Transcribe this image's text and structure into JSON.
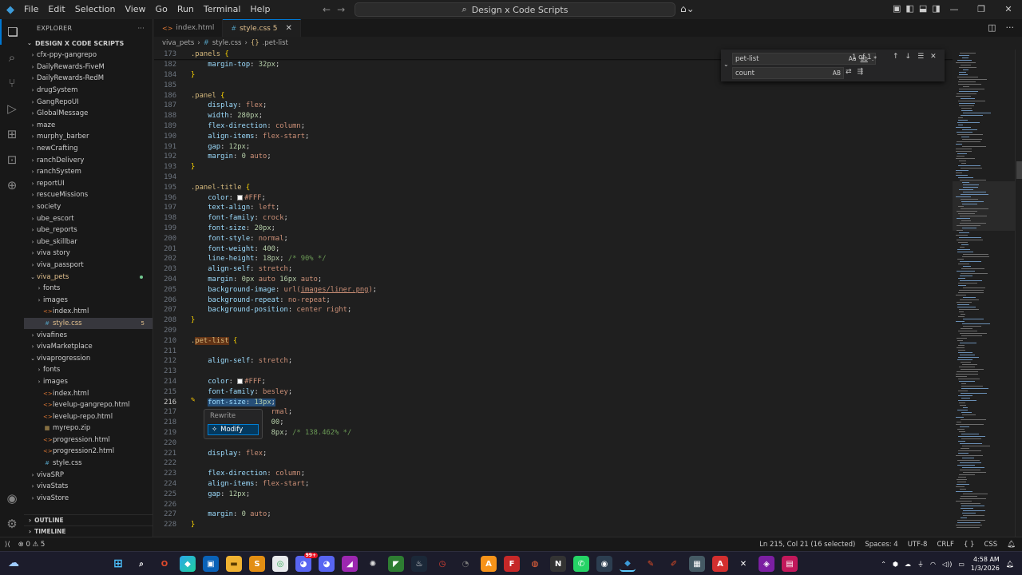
{
  "menu": [
    "File",
    "Edit",
    "Selection",
    "View",
    "Go",
    "Run",
    "Terminal",
    "Help"
  ],
  "command_center": "Design x Code Scripts",
  "explorer": {
    "title": "EXPLORER",
    "folder": "DESIGN X CODE SCRIPTS",
    "tree": [
      {
        "label": "cfx-ppy-gangrepo",
        "depth": 1,
        "chev": "›"
      },
      {
        "label": "DailyRewards-FiveM",
        "depth": 1,
        "chev": "›"
      },
      {
        "label": "DailyRewards-RedM",
        "depth": 1,
        "chev": "›"
      },
      {
        "label": "drugSystem",
        "depth": 1,
        "chev": "›"
      },
      {
        "label": "GangRepoUI",
        "depth": 1,
        "chev": "›"
      },
      {
        "label": "GlobalMessage",
        "depth": 1,
        "chev": "›"
      },
      {
        "label": "maze",
        "depth": 1,
        "chev": "›"
      },
      {
        "label": "murphy_barber",
        "depth": 1,
        "chev": "›"
      },
      {
        "label": "newCrafting",
        "depth": 1,
        "chev": "›"
      },
      {
        "label": "ranchDelivery",
        "depth": 1,
        "chev": "›"
      },
      {
        "label": "ranchSystem",
        "depth": 1,
        "chev": "›"
      },
      {
        "label": "reportUI",
        "depth": 1,
        "chev": "›"
      },
      {
        "label": "rescueMissions",
        "depth": 1,
        "chev": "›"
      },
      {
        "label": "society",
        "depth": 1,
        "chev": "›"
      },
      {
        "label": "ube_escort",
        "depth": 1,
        "chev": "›"
      },
      {
        "label": "ube_reports",
        "depth": 1,
        "chev": "›"
      },
      {
        "label": "ube_skillbar",
        "depth": 1,
        "chev": "›"
      },
      {
        "label": "viva story",
        "depth": 1,
        "chev": "›"
      },
      {
        "label": "viva_passport",
        "depth": 1,
        "chev": "›"
      },
      {
        "label": "viva_pets",
        "depth": 1,
        "chev": "⌄",
        "mod": true,
        "dot": true
      },
      {
        "label": "fonts",
        "depth": 2,
        "chev": "›"
      },
      {
        "label": "images",
        "depth": 2,
        "chev": "›"
      },
      {
        "label": "index.html",
        "depth": 2,
        "chev": "",
        "icon": "<>",
        "iconColor": "#e37933"
      },
      {
        "label": "style.css",
        "depth": 2,
        "chev": "",
        "icon": "#",
        "iconColor": "#519aba",
        "selected": true,
        "mod": true,
        "badge": "5"
      },
      {
        "label": "vivafines",
        "depth": 1,
        "chev": "›"
      },
      {
        "label": "vivaMarketplace",
        "depth": 1,
        "chev": "›"
      },
      {
        "label": "vivaprogression",
        "depth": 1,
        "chev": "⌄"
      },
      {
        "label": "fonts",
        "depth": 2,
        "chev": "›"
      },
      {
        "label": "images",
        "depth": 2,
        "chev": "›"
      },
      {
        "label": "index.html",
        "depth": 2,
        "chev": "",
        "icon": "<>",
        "iconColor": "#e37933"
      },
      {
        "label": "levelup-gangrepo.html",
        "depth": 2,
        "chev": "",
        "icon": "<>",
        "iconColor": "#e37933"
      },
      {
        "label": "levelup-repo.html",
        "depth": 2,
        "chev": "",
        "icon": "<>",
        "iconColor": "#e37933"
      },
      {
        "label": "myrepo.zip",
        "depth": 2,
        "chev": "",
        "icon": "▦",
        "iconColor": "#c5a15a"
      },
      {
        "label": "progression.html",
        "depth": 2,
        "chev": "",
        "icon": "<>",
        "iconColor": "#e37933"
      },
      {
        "label": "progression2.html",
        "depth": 2,
        "chev": "",
        "icon": "<>",
        "iconColor": "#e37933"
      },
      {
        "label": "style.css",
        "depth": 2,
        "chev": "",
        "icon": "#",
        "iconColor": "#519aba"
      },
      {
        "label": "vivaSRP",
        "depth": 1,
        "chev": "›"
      },
      {
        "label": "vivaStats",
        "depth": 1,
        "chev": "›"
      },
      {
        "label": "vivaStore",
        "depth": 1,
        "chev": "›"
      }
    ],
    "outline": "OUTLINE",
    "timeline": "TIMELINE"
  },
  "tabs": [
    {
      "label": "index.html",
      "icon": "<>",
      "active": false
    },
    {
      "label": "style.css 5",
      "icon": "#",
      "active": true
    }
  ],
  "breadcrumb": [
    "viva_pets",
    "#",
    "style.css",
    "{}",
    ".pet-list"
  ],
  "find": {
    "search_value": "pet-list",
    "replace_value": "count",
    "match_count": "1 of 1",
    "opt_case": "Aa",
    "opt_word": "ab",
    "opt_regex": ".*",
    "opt_preserve": "AB"
  },
  "code_action": {
    "title": "Rewrite",
    "item": "Modify"
  },
  "code_lines": [
    {
      "n": "173",
      "html": "<span class='sel'>.panels</span> <span class='brace'>{</span>"
    },
    {
      "n": "182",
      "html": "    <span class='prop'>margin-top</span>: <span class='num'>32px</span>;"
    },
    {
      "n": "184",
      "html": "<span class='brace'>}</span>"
    },
    {
      "n": "185",
      "html": ""
    },
    {
      "n": "186",
      "html": "<span class='sel'>.panel</span> <span class='brace'>{</span>"
    },
    {
      "n": "187",
      "html": "    <span class='prop'>display</span>: <span class='val'>flex</span>;"
    },
    {
      "n": "188",
      "html": "    <span class='prop'>width</span>: <span class='num'>280px</span>;"
    },
    {
      "n": "189",
      "html": "    <span class='prop'>flex-direction</span>: <span class='val'>column</span>;"
    },
    {
      "n": "190",
      "html": "    <span class='prop'>align-items</span>: <span class='val'>flex-start</span>;"
    },
    {
      "n": "191",
      "html": "    <span class='prop'>gap</span>: <span class='num'>12px</span>;"
    },
    {
      "n": "192",
      "html": "    <span class='prop'>margin</span>: <span class='num'>0</span> <span class='val'>auto</span>;"
    },
    {
      "n": "193",
      "html": "<span class='brace'>}</span>"
    },
    {
      "n": "194",
      "html": ""
    },
    {
      "n": "195",
      "html": "<span class='sel'>.panel-title</span> <span class='brace'>{</span>"
    },
    {
      "n": "196",
      "html": "    <span class='prop'>color</span>: <span class='swatch'></span><span class='val'>#FFF</span>;"
    },
    {
      "n": "197",
      "html": "    <span class='prop'>text-align</span>: <span class='val'>left</span>;"
    },
    {
      "n": "198",
      "html": "    <span class='prop'>font-family</span>: <span class='val'>crock</span>;"
    },
    {
      "n": "199",
      "html": "    <span class='prop'>font-size</span>: <span class='num'>20px</span>;"
    },
    {
      "n": "200",
      "html": "    <span class='prop'>font-style</span>: <span class='val'>normal</span>;"
    },
    {
      "n": "201",
      "html": "    <span class='prop'>font-weight</span>: <span class='num'>400</span>;"
    },
    {
      "n": "202",
      "html": "    <span class='prop'>line-height</span>: <span class='num'>18px</span>; <span class='cmt'>/* 90% */</span>"
    },
    {
      "n": "203",
      "html": "    <span class='prop'>align-self</span>: <span class='val'>stretch</span>;"
    },
    {
      "n": "204",
      "html": "    <span class='prop'>margin</span>: <span class='num'>0px</span> <span class='val'>auto</span> <span class='num'>16px</span> <span class='val'>auto</span>;"
    },
    {
      "n": "205",
      "html": "    <span class='prop'>background-image</span>: <span class='val'>url(</span><span class='val' style='text-decoration:underline'>images/liner.png</span><span class='val'>)</span>;"
    },
    {
      "n": "206",
      "html": "    <span class='prop'>background-repeat</span>: <span class='val'>no-repeat</span>;"
    },
    {
      "n": "207",
      "html": "    <span class='prop'>background-position</span>: <span class='val'>center right</span>;"
    },
    {
      "n": "208",
      "html": "<span class='brace'>}</span>"
    },
    {
      "n": "209",
      "html": ""
    },
    {
      "n": "210",
      "html": "<span class='sel'>.<span class='hl'>pet-list</span></span> <span class='brace'>{</span>"
    },
    {
      "n": "211",
      "html": ""
    },
    {
      "n": "212",
      "html": "    <span class='prop'>align-self</span>: <span class='val'>stretch</span>;"
    },
    {
      "n": "213",
      "html": ""
    },
    {
      "n": "214",
      "html": "    <span class='prop'>color</span>: <span class='swatch'></span><span class='val'>#FFF</span>;"
    },
    {
      "n": "215",
      "html": "    <span class='prop'>font-family</span>: <span class='val'>besley</span>;"
    },
    {
      "n": "216",
      "html": "    <span class='selbg'><span class='prop'>font-size</span>: <span class='num'>13px</span>;</span>",
      "cur": true
    },
    {
      "n": "217",
      "html": "                   <span class='val'>rmal</span>;"
    },
    {
      "n": "218",
      "html": "                   <span class='num'>00</span>;"
    },
    {
      "n": "219",
      "html": "                   <span class='num'>8px</span>; <span class='cmt'>/* 138.462% */</span>"
    },
    {
      "n": "220",
      "html": ""
    },
    {
      "n": "221",
      "html": "    <span class='prop'>display</span>: <span class='val'>flex</span>;"
    },
    {
      "n": "222",
      "html": ""
    },
    {
      "n": "223",
      "html": "    <span class='prop'>flex-direction</span>: <span class='val'>column</span>;"
    },
    {
      "n": "224",
      "html": "    <span class='prop'>align-items</span>: <span class='val'>flex-start</span>;"
    },
    {
      "n": "225",
      "html": "    <span class='prop'>gap</span>: <span class='num'>12px</span>;"
    },
    {
      "n": "226",
      "html": ""
    },
    {
      "n": "227",
      "html": "    <span class='prop'>margin</span>: <span class='num'>0</span> <span class='val'>auto</span>;"
    },
    {
      "n": "228",
      "html": "<span class='brace'>}</span>"
    }
  ],
  "status": {
    "errors": "0",
    "warnings": "5",
    "position": "Ln 215, Col 21 (16 selected)",
    "spaces": "Spaces: 4",
    "encoding": "UTF-8",
    "eol": "CRLF",
    "language": "CSS"
  },
  "taskbar": {
    "time": "4:58 AM",
    "date": "1/3/2026",
    "notif_badge": "99+"
  },
  "colors": {
    "accent": "#0078d4",
    "modified": "#e2c08d"
  }
}
